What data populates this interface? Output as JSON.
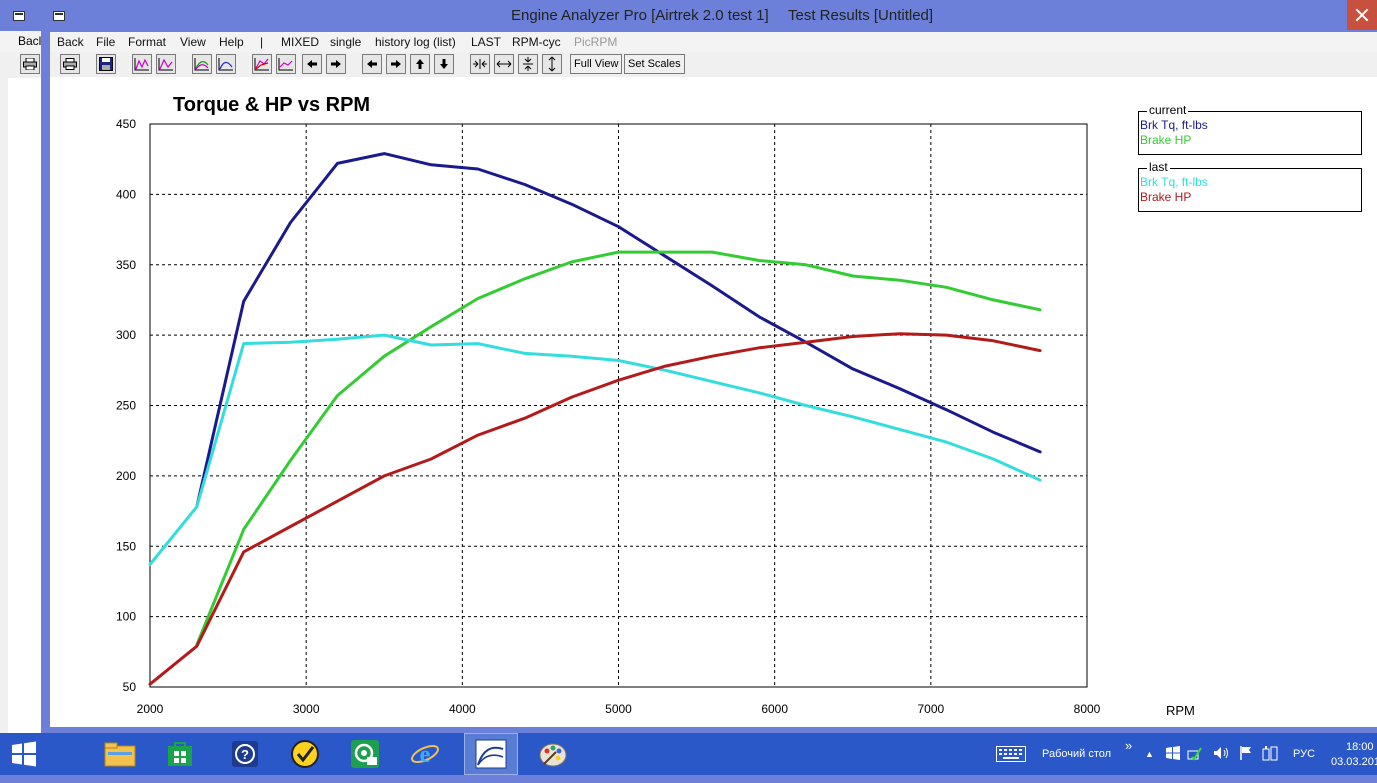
{
  "window": {
    "title": "Engine Analyzer Pro [Airtrek 2.0 test 1]",
    "subtitle": "Test Results [Untitled]"
  },
  "background_window": {
    "menu_fragment": "Bacl"
  },
  "menu": [
    {
      "label": "Back"
    },
    {
      "label": "File"
    },
    {
      "label": "Format"
    },
    {
      "label": "View"
    },
    {
      "label": "Help"
    },
    {
      "label": "|"
    },
    {
      "label": "MIXED"
    },
    {
      "label": "single"
    },
    {
      "label": "history log (list)"
    },
    {
      "label": "LAST"
    },
    {
      "label": "RPM-cyc"
    },
    {
      "label": "PicRPM",
      "disabled": true
    }
  ],
  "toolbar": {
    "full_view": "Full View",
    "set_scales": "Set Scales",
    "icons": [
      "print-icon",
      "save-icon",
      "graph-icon",
      "graph-icon",
      "graph-icon",
      "graph-icon",
      "graph-icon",
      "graph-icon",
      "arrow-left-icon",
      "arrow-right-icon",
      "arrow-left-icon",
      "arrow-right-icon",
      "arrow-up-icon",
      "arrow-down-icon",
      "shrink-horizontal-icon",
      "expand-horizontal-icon",
      "shrink-vertical-icon",
      "expand-vertical-icon"
    ]
  },
  "chart_data": {
    "type": "line",
    "title": "Torque & HP vs RPM",
    "xlabel": "RPM",
    "ylabel": "",
    "xlim": [
      2000,
      8000
    ],
    "ylim": [
      50,
      450
    ],
    "x_ticks": [
      "2000",
      "3000",
      "4000",
      "5000",
      "6000",
      "7000",
      "8000"
    ],
    "y_ticks": [
      "450",
      "400",
      "350",
      "300",
      "250",
      "200",
      "150",
      "100",
      "50"
    ],
    "grid": true,
    "legend_placement": "top-right",
    "legend_groups": [
      {
        "title": "current",
        "entries": [
          {
            "label": "Brk Tq, ft-lbs",
            "color": "#1a1a8c"
          },
          {
            "label": "Brake HP",
            "color": "#33cc33"
          }
        ]
      },
      {
        "title": "last",
        "entries": [
          {
            "label": "Brk Tq, ft-lbs",
            "color": "#33dddd"
          },
          {
            "label": "Brake HP",
            "color": "#b31b1b"
          }
        ]
      }
    ],
    "series": [
      {
        "group": "current",
        "color": "#1a1a8c",
        "points": [
          [
            2300,
            178
          ],
          [
            2600,
            324
          ],
          [
            2900,
            380
          ],
          [
            3200,
            422
          ],
          [
            3500,
            429
          ],
          [
            3800,
            421
          ],
          [
            4100,
            418
          ],
          [
            4400,
            407
          ],
          [
            4700,
            393
          ],
          [
            5000,
            377
          ],
          [
            5300,
            356
          ],
          [
            5600,
            335
          ],
          [
            5900,
            313
          ],
          [
            6200,
            295
          ],
          [
            6500,
            276
          ],
          [
            6800,
            262
          ],
          [
            7100,
            247
          ],
          [
            7400,
            231
          ],
          [
            7700,
            217
          ]
        ]
      },
      {
        "group": "current",
        "color": "#33cc33",
        "points": [
          [
            2300,
            80
          ],
          [
            2600,
            162
          ],
          [
            2900,
            211
          ],
          [
            3200,
            257
          ],
          [
            3500,
            285
          ],
          [
            3800,
            306
          ],
          [
            4100,
            326
          ],
          [
            4400,
            340
          ],
          [
            4700,
            352
          ],
          [
            5000,
            359
          ],
          [
            5300,
            359
          ],
          [
            5600,
            359
          ],
          [
            5900,
            353
          ],
          [
            6200,
            350
          ],
          [
            6500,
            342
          ],
          [
            6800,
            339
          ],
          [
            7100,
            334
          ],
          [
            7400,
            325
          ],
          [
            7700,
            318
          ]
        ]
      },
      {
        "group": "last",
        "color": "#33dddd",
        "points": [
          [
            2000,
            137
          ],
          [
            2300,
            178
          ],
          [
            2600,
            294
          ],
          [
            2900,
            295
          ],
          [
            3200,
            297
          ],
          [
            3500,
            300
          ],
          [
            3800,
            293
          ],
          [
            4100,
            294
          ],
          [
            4400,
            287
          ],
          [
            4700,
            285
          ],
          [
            5000,
            282
          ],
          [
            5300,
            275
          ],
          [
            5600,
            267
          ],
          [
            5900,
            259
          ],
          [
            6200,
            250
          ],
          [
            6500,
            242
          ],
          [
            6800,
            233
          ],
          [
            7100,
            224
          ],
          [
            7400,
            212
          ],
          [
            7700,
            197
          ]
        ]
      },
      {
        "group": "last",
        "color": "#b31b1b",
        "points": [
          [
            2000,
            52
          ],
          [
            2300,
            79
          ],
          [
            2600,
            146
          ],
          [
            2900,
            164
          ],
          [
            3200,
            182
          ],
          [
            3500,
            200
          ],
          [
            3800,
            212
          ],
          [
            4100,
            229
          ],
          [
            4400,
            241
          ],
          [
            4700,
            256
          ],
          [
            5000,
            268
          ],
          [
            5300,
            278
          ],
          [
            5600,
            285
          ],
          [
            5900,
            291
          ],
          [
            6200,
            295
          ],
          [
            6500,
            299
          ],
          [
            6800,
            301
          ],
          [
            7100,
            300
          ],
          [
            7400,
            296
          ],
          [
            7700,
            289
          ]
        ]
      }
    ]
  },
  "taskbar": {
    "apps": [
      {
        "name": "start-icon"
      },
      {
        "name": "file-explorer-icon"
      },
      {
        "name": "store-icon"
      },
      {
        "name": "help-icon"
      },
      {
        "name": "norton-icon"
      },
      {
        "name": "mail-app-icon"
      },
      {
        "name": "internet-explorer-icon"
      },
      {
        "name": "engine-analyzer-icon",
        "active": true
      },
      {
        "name": "paint-icon"
      }
    ],
    "keyboard_icon": "keyboard-icon",
    "desktop_label": "Рабочий стол",
    "chevron": "»",
    "lang": "РУС",
    "time": "18:00",
    "date": "03.03.201"
  }
}
